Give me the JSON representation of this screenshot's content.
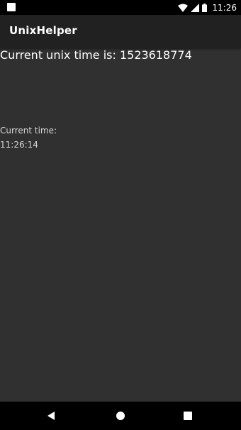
{
  "status_bar": {
    "time": "11:26",
    "icons": [
      "notification-icon",
      "wifi-icon",
      "signal-icon",
      "battery-icon"
    ]
  },
  "app_bar": {
    "title": "UnixHelper"
  },
  "main": {
    "unix_text": "Current unix time is: 1523618774",
    "current_time_label": "Current time:",
    "current_time_value": "11:26:14"
  },
  "nav_bar": {
    "buttons": [
      "back-icon",
      "home-icon",
      "recents-icon"
    ]
  },
  "colors": {
    "background": "#303030",
    "app_bar": "#212121",
    "status_bar": "#000000",
    "text_primary": "#ffffff",
    "text_secondary": "#d8d8d8"
  }
}
